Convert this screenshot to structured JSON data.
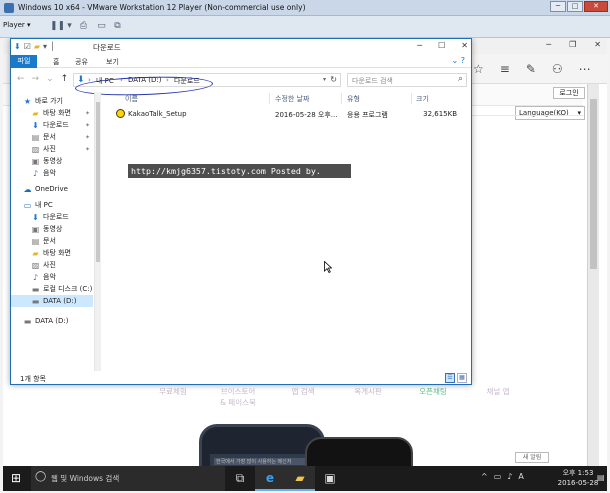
{
  "vm": {
    "title": "Windows 10 x64 - VMware Workstation 12 Player (Non-commercial use only)",
    "player_label": "Player",
    "ctrl_min": "─",
    "ctrl_max": "□",
    "ctrl_close": "✕"
  },
  "edge": {
    "ctrl_min": "─",
    "ctrl_max": "❐",
    "ctrl_close": "✕",
    "login": "로그인",
    "language": "Language(KO)",
    "nav": [
      "무료체험",
      "브이스토어 & 페이스북",
      "앱 검색",
      "옥게시판",
      "오픈채팅",
      "채널 앱"
    ],
    "nav_active_index": 4,
    "phone_text": "한국에서 가장 많이 사용하는 메신저",
    "ad_label": "새 알림"
  },
  "explorer": {
    "title": "다운로드",
    "ctrl_min": "─",
    "ctrl_max": "☐",
    "ctrl_close": "✕",
    "ribbon": {
      "file": "파일",
      "home": "홈",
      "share": "공유",
      "view": "보기",
      "help": "?"
    },
    "address": {
      "separator": "›",
      "crumbs": [
        "내 PC",
        "DATA (D:)",
        "다운로드"
      ]
    },
    "search_placeholder": "다운로드 검색",
    "sidebar": [
      {
        "label": "바로 가기",
        "icon": "star-icon",
        "pinned": false
      },
      {
        "label": "바탕 화면",
        "icon": "folder-icon",
        "pinned": true
      },
      {
        "label": "다운로드",
        "icon": "download-icon",
        "pinned": true
      },
      {
        "label": "문서",
        "icon": "document-icon",
        "pinned": true
      },
      {
        "label": "사진",
        "icon": "picture-icon",
        "pinned": true
      },
      {
        "label": "동영상",
        "icon": "video-icon",
        "pinned": false
      },
      {
        "label": "음악",
        "icon": "music-icon",
        "pinned": false
      },
      {
        "label": "OneDrive",
        "icon": "cloud-icon",
        "pinned": false
      },
      {
        "label": "내 PC",
        "icon": "pc-icon",
        "pinned": false
      },
      {
        "label": "다운로드",
        "icon": "download-icon",
        "pinned": false
      },
      {
        "label": "동영상",
        "icon": "video-icon",
        "pinned": false
      },
      {
        "label": "문서",
        "icon": "document-icon",
        "pinned": false
      },
      {
        "label": "바탕 화면",
        "icon": "folder-icon",
        "pinned": false
      },
      {
        "label": "사진",
        "icon": "picture-icon",
        "pinned": false
      },
      {
        "label": "음악",
        "icon": "music-icon",
        "pinned": false
      },
      {
        "label": "로컬 디스크 (C:)",
        "icon": "drive-icon",
        "pinned": false
      },
      {
        "label": "DATA (D:)",
        "icon": "drive-icon",
        "pinned": false,
        "selected": true
      },
      {
        "label": "DATA (D:)",
        "icon": "drive-icon",
        "pinned": false
      }
    ],
    "columns": {
      "name": "이름",
      "modified": "수정한 날짜",
      "type": "유형",
      "size": "크기"
    },
    "files": [
      {
        "name": "KakaoTalk_Setup",
        "modified": "2016-05-28 오후...",
        "type": "응용 프로그램",
        "size": "32,615KB"
      }
    ],
    "watermark": "http://kmjg6357.tistoty.com  Posted by.",
    "status": "1개 항목"
  },
  "taskbar": {
    "search_placeholder": "웹 및 Windows 검색",
    "ime": "A",
    "time": "오후 1:53",
    "date": "2016-05-28"
  },
  "colors": {
    "accent": "#1979ca",
    "selection": "#cce8ff",
    "watermark_bg": "#4e4e4e",
    "active_nav": "#58c28a"
  }
}
